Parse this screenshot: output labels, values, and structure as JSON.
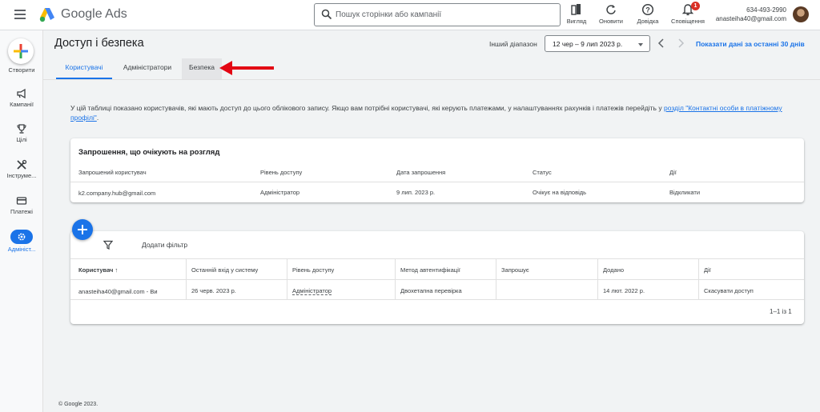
{
  "app": {
    "brand": "Google Ads"
  },
  "search": {
    "placeholder": "Пошук сторінки або кампанії"
  },
  "toolbar": {
    "view_label": "Вигляд",
    "refresh_label": "Оновити",
    "help_label": "Довідка",
    "notifications_label": "Сповіщення",
    "notifications_count": "1"
  },
  "account": {
    "phone": "634-493-2990",
    "email": "anasteiha40@gmail.com"
  },
  "sidebar": {
    "items": [
      {
        "label": "Створити",
        "icon": "plus-icon"
      },
      {
        "label": "Кампанії",
        "icon": "megaphone-icon"
      },
      {
        "label": "Цілі",
        "icon": "trophy-icon"
      },
      {
        "label": "Інструме...",
        "icon": "tools-icon"
      },
      {
        "label": "Платежі",
        "icon": "credit-card-icon"
      },
      {
        "label": "Адмініст...",
        "icon": "gear-icon"
      }
    ]
  },
  "header": {
    "title": "Доступ і безпека",
    "range_label": "Інший діапазон",
    "range_value": "12 чер – 9 лип 2023 р.",
    "show_30_days": "Показати дані за останні 30 днів"
  },
  "tabs": [
    {
      "label": "Користувачі",
      "active": true
    },
    {
      "label": "Адміністратори",
      "active": false
    },
    {
      "label": "Безпека",
      "active": false
    }
  ],
  "intro": {
    "text": "У цій таблиці показано користувачів, які мають доступ до цього облікового запису. Якщо вам потрібні користувачі, які керують платежами, у налаштуваннях рахунків і платежів перейдіть у ",
    "link": "розділ \"Контактні особи в платіжному профілі\"",
    "end": "."
  },
  "invitations": {
    "title": "Запрошення, що очікують на розгляд",
    "columns": [
      "Запрошений користувач",
      "Рівень доступу",
      "Дата запрошення",
      "Статус",
      "Дії"
    ],
    "rows": [
      [
        "k2.company.hub@gmail.com",
        "Адміністратор",
        "9 лип. 2023 р.",
        "Очікує на відповідь",
        "Відкликати"
      ]
    ]
  },
  "users": {
    "add_filter": "Додати фільтр",
    "columns": [
      "Користувач",
      "Останній вхід у систему",
      "Рівень доступу",
      "Метод автентифікації",
      "Запрошує",
      "Додано",
      "Дії"
    ],
    "rows": [
      [
        "anasteiha40@gmail.com - Ви",
        "26 черв. 2023 р.",
        "Адміністратор",
        "Двохетапна перевірка",
        "",
        "14 лют. 2022 р.",
        "Скасувати доступ"
      ]
    ],
    "pagination": "1–1 із 1"
  },
  "footer": {
    "copyright": "© Google 2023."
  },
  "colors": {
    "accent": "#1a73e8",
    "arrow": "#e30613"
  }
}
